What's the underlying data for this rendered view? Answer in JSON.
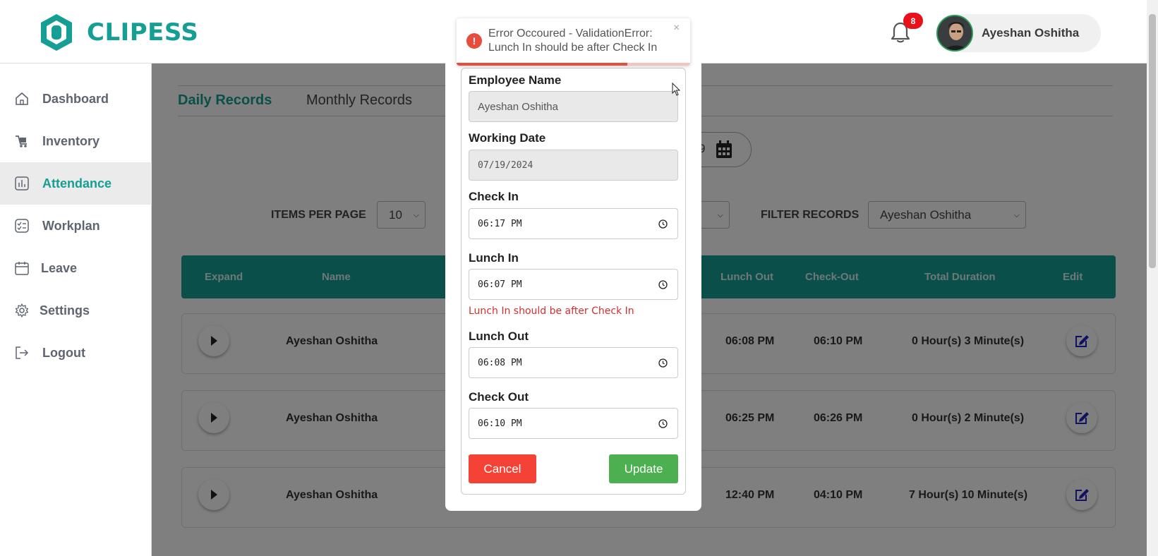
{
  "app": {
    "brand": "CLIPESS",
    "accent_color": "#159e93"
  },
  "header": {
    "notifications_count": "8",
    "user_name": "Ayeshan Oshitha"
  },
  "sidebar": {
    "items": [
      {
        "label": "Dashboard",
        "icon": "home-icon"
      },
      {
        "label": "Inventory",
        "icon": "inventory-icon"
      },
      {
        "label": "Attendance",
        "icon": "chart-icon",
        "active": true
      },
      {
        "label": "Workplan",
        "icon": "checklist-icon"
      },
      {
        "label": "Leave",
        "icon": "calendar-icon"
      },
      {
        "label": "Settings",
        "icon": "gear-icon"
      },
      {
        "label": "Logout",
        "icon": "logout-icon"
      }
    ]
  },
  "main": {
    "tabs": [
      "Daily Records",
      "Monthly Records"
    ],
    "date_fragment": "9",
    "items_per_page_label": "ITEMS PER PAGE",
    "items_per_page_value": "10",
    "filter_label": "FILTER RECORDS",
    "filter_value": "Ayeshan Oshitha",
    "table_headers": [
      "Expand",
      "Name",
      "Lunch Out",
      "Check-Out",
      "Total Duration",
      "Edit"
    ],
    "rows": [
      {
        "name": "Ayeshan Oshitha",
        "lunch_out": "06:08 PM",
        "check_out": "06:10 PM",
        "total": "0 Hour(s) 3 Minute(s)"
      },
      {
        "name": "Ayeshan Oshitha",
        "lunch_out": "06:25 PM",
        "check_out": "06:26 PM",
        "total": "0 Hour(s) 2 Minute(s)"
      },
      {
        "name": "Ayeshan Oshitha",
        "lunch_out": "12:40 PM",
        "check_out": "04:10 PM",
        "total": "7 Hour(s) 10 Minute(s)"
      }
    ]
  },
  "modal": {
    "employee_name_label": "Employee Name",
    "employee_name_value": "Ayeshan Oshitha",
    "working_date_label": "Working Date",
    "working_date_value": "07/19/2024",
    "check_in_label": "Check In",
    "check_in_value": "06:17 PM",
    "lunch_in_label": "Lunch In",
    "lunch_in_value": "06:07 PM",
    "lunch_in_error": "Lunch In should be after Check In",
    "lunch_out_label": "Lunch Out",
    "lunch_out_value": "06:08 PM",
    "check_out_label": "Check Out",
    "check_out_value": "06:10 PM",
    "cancel_label": "Cancel",
    "update_label": "Update"
  },
  "toast": {
    "message": "Error Occoured - ValidationError: Lunch In should be after Check In",
    "close_glyph": "×",
    "progress_fraction": 0.73
  }
}
